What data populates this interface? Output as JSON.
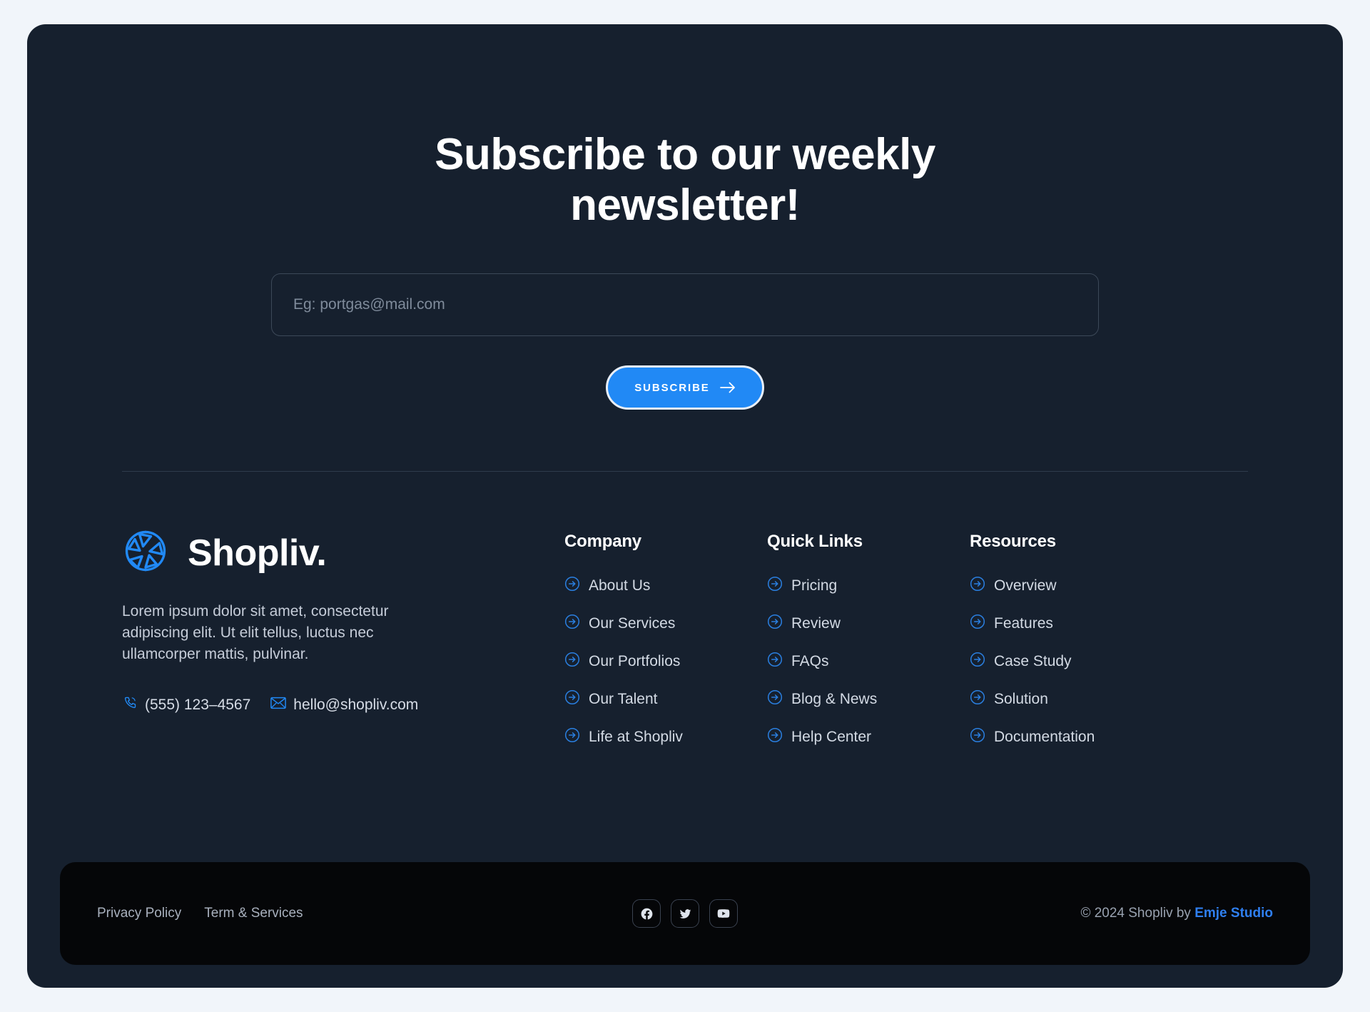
{
  "theme": {
    "page_background": "#f1f5fa",
    "card_background": "#16202e",
    "bottom_bar_background": "#050608",
    "accent_blue": "#2189f5",
    "link_blue": "#2f7ff0",
    "body_text": "#d3dae4"
  },
  "newsletter": {
    "title": "Subscribe to our weekly newsletter!",
    "email_placeholder": "Eg: portgas@mail.com",
    "email_value": "",
    "subscribe_label": "SUBSCRIBE",
    "arrow_icon": "arrow-right-icon"
  },
  "brand": {
    "logo_icon": "aperture-shutter-icon",
    "name": "Shopliv.",
    "description": "Lorem ipsum dolor sit amet, consectetur adipiscing elit. Ut elit tellus, luctus nec ullamcorper mattis, pulvinar.",
    "phone": "(555) 123–4567",
    "phone_icon": "phone-icon",
    "email": "hello@shopliv.com",
    "email_icon": "envelope-icon"
  },
  "footer_columns": [
    {
      "title": "Company",
      "links": [
        {
          "label": "About Us",
          "icon": "arrow-circle-right-icon"
        },
        {
          "label": "Our Services",
          "icon": "arrow-circle-right-icon"
        },
        {
          "label": "Our Portfolios",
          "icon": "arrow-circle-right-icon"
        },
        {
          "label": "Our Talent",
          "icon": "arrow-circle-right-icon"
        },
        {
          "label": "Life at Shopliv",
          "icon": "arrow-circle-right-icon"
        }
      ]
    },
    {
      "title": "Quick Links",
      "links": [
        {
          "label": "Pricing",
          "icon": "arrow-circle-right-icon"
        },
        {
          "label": "Review",
          "icon": "arrow-circle-right-icon"
        },
        {
          "label": "FAQs",
          "icon": "arrow-circle-right-icon"
        },
        {
          "label": "Blog & News",
          "icon": "arrow-circle-right-icon"
        },
        {
          "label": "Help Center",
          "icon": "arrow-circle-right-icon"
        }
      ]
    },
    {
      "title": "Resources",
      "links": [
        {
          "label": "Overview",
          "icon": "arrow-circle-right-icon"
        },
        {
          "label": "Features",
          "icon": "arrow-circle-right-icon"
        },
        {
          "label": "Case Study",
          "icon": "arrow-circle-right-icon"
        },
        {
          "label": "Solution",
          "icon": "arrow-circle-right-icon"
        },
        {
          "label": "Documentation",
          "icon": "arrow-circle-right-icon"
        }
      ]
    }
  ],
  "bottom_bar": {
    "legal_links": [
      {
        "label": "Privacy Policy"
      },
      {
        "label": "Term & Services"
      }
    ],
    "socials": [
      {
        "name": "facebook-icon",
        "label": "Facebook"
      },
      {
        "name": "twitter-icon",
        "label": "Twitter"
      },
      {
        "name": "youtube-icon",
        "label": "YouTube"
      }
    ],
    "copyright_prefix": "© 2024 Shopliv by ",
    "copyright_studio": "Emje Studio"
  }
}
